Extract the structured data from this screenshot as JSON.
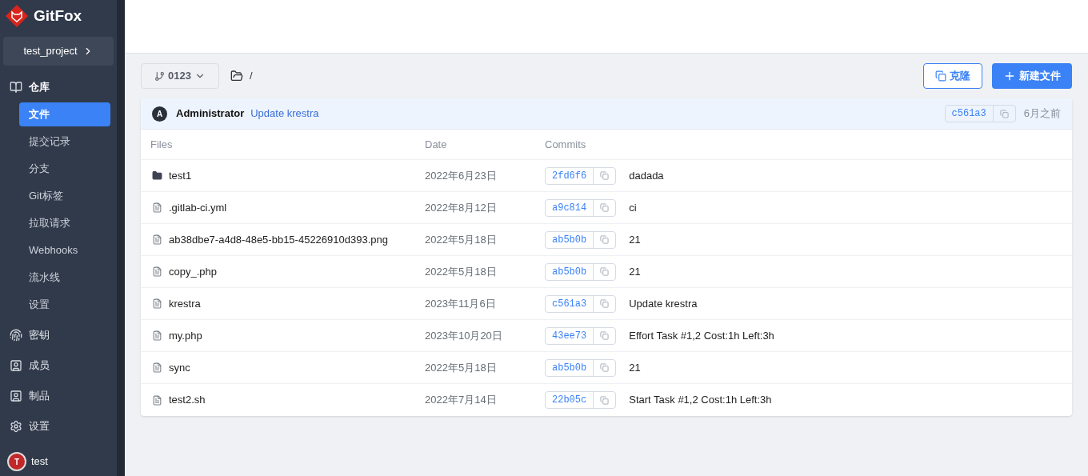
{
  "brand": {
    "name": "GitFox"
  },
  "project": {
    "name": "test_project"
  },
  "sidebar": {
    "items": [
      {
        "label": "仓库",
        "kind": "section",
        "children": [
          {
            "label": "文件",
            "selected": true
          },
          {
            "label": "提交记录",
            "selected": false
          },
          {
            "label": "分支",
            "selected": false
          },
          {
            "label": "Git标签",
            "selected": false
          },
          {
            "label": "拉取请求",
            "selected": false
          },
          {
            "label": "Webhooks",
            "selected": false
          },
          {
            "label": "流水线",
            "selected": false
          },
          {
            "label": "设置",
            "selected": false
          }
        ]
      },
      {
        "label": "密钥",
        "kind": "key"
      },
      {
        "label": "成员",
        "kind": "person"
      },
      {
        "label": "制品",
        "kind": "person"
      },
      {
        "label": "设置",
        "kind": "gear"
      }
    ]
  },
  "user": {
    "initial": "T",
    "name": "test"
  },
  "toolbar": {
    "branch": "0123",
    "path": "/",
    "clone_button": "克隆",
    "new_file_button": "新建文件"
  },
  "last_commit": {
    "avatar": "A",
    "author": "Administrator",
    "message": "Update krestra",
    "hash": "c561a3",
    "time": "6月之前"
  },
  "table": {
    "columns": [
      "Files",
      "Date",
      "Commits"
    ],
    "rows": [
      {
        "kind": "folder",
        "name": "test1",
        "date": "2022年6月23日",
        "hash": "2fd6f6",
        "message": "dadada"
      },
      {
        "kind": "file",
        "name": ".gitlab-ci.yml",
        "date": "2022年8月12日",
        "hash": "a9c814",
        "message": "ci"
      },
      {
        "kind": "file",
        "name": "ab38dbe7-a4d8-48e5-bb15-45226910d393.png",
        "date": "2022年5月18日",
        "hash": "ab5b0b",
        "message": "21"
      },
      {
        "kind": "file",
        "name": "copy_.php",
        "date": "2022年5月18日",
        "hash": "ab5b0b",
        "message": "21"
      },
      {
        "kind": "file",
        "name": "krestra",
        "date": "2023年11月6日",
        "hash": "c561a3",
        "message": "Update krestra"
      },
      {
        "kind": "file",
        "name": "my.php",
        "date": "2023年10月20日",
        "hash": "43ee73",
        "message": "Effort Task #1,2 Cost:1h Left:3h"
      },
      {
        "kind": "file",
        "name": "sync",
        "date": "2022年5月18日",
        "hash": "ab5b0b",
        "message": "21"
      },
      {
        "kind": "file",
        "name": "test2.sh",
        "date": "2022年7月14日",
        "hash": "22b05c",
        "message": "Start Task #1,2 Cost:1h Left:3h"
      }
    ]
  }
}
